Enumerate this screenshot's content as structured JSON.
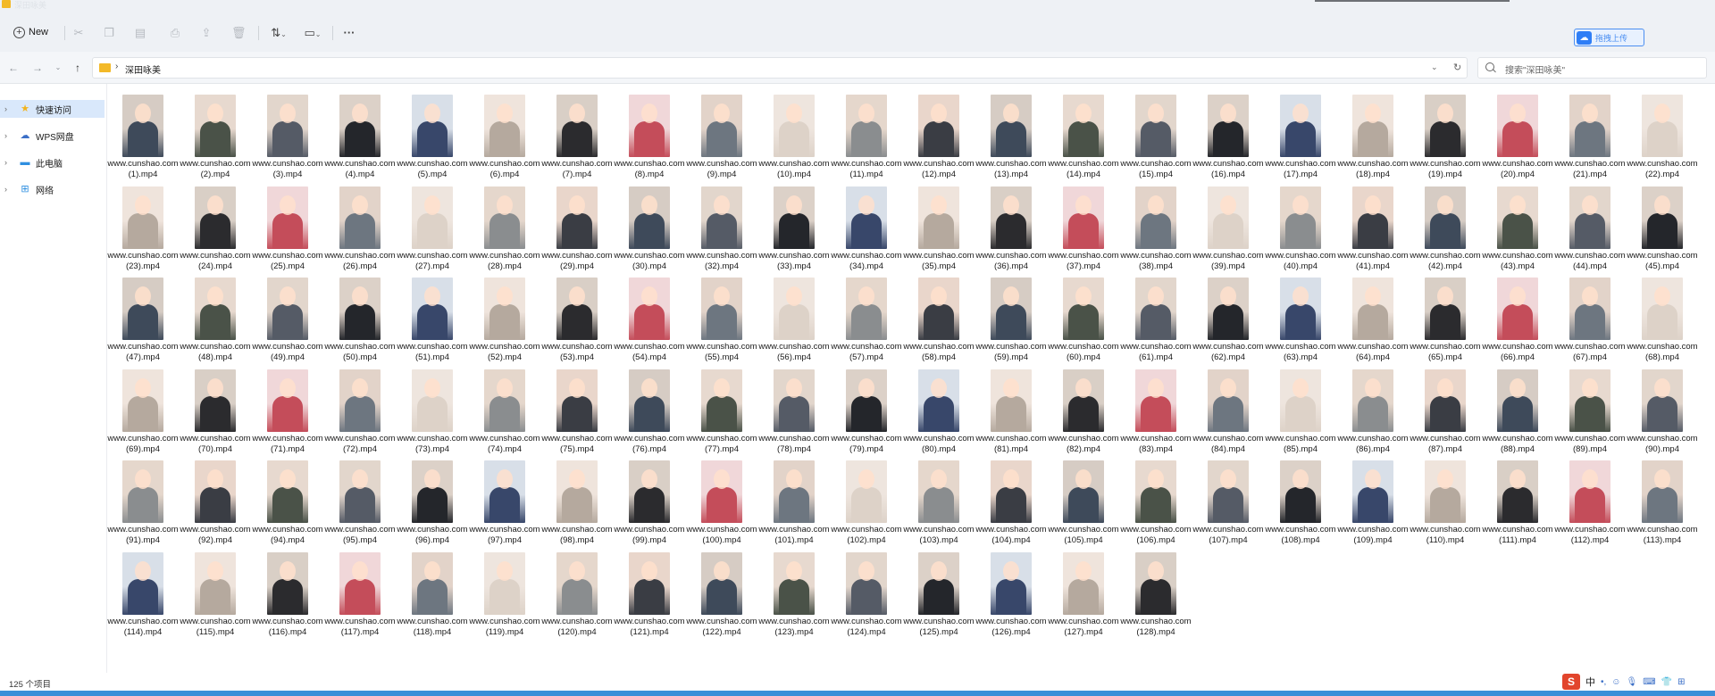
{
  "window": {
    "title": "深田咏美"
  },
  "toolbar": {
    "new_label": "New",
    "items": [
      "cut-icon",
      "copy-icon",
      "paste-icon",
      "rename-icon",
      "share-icon",
      "delete-icon",
      "sort-icon",
      "view-icon",
      "more-icon"
    ],
    "more_label": "···",
    "upload_label": "拖拽上传"
  },
  "address": {
    "path": "深田咏美",
    "search_placeholder": "搜索\"深田咏美\""
  },
  "sidebar": {
    "items": [
      {
        "label": "快速访问",
        "icon": "star-icon"
      },
      {
        "label": "WPS网盘",
        "icon": "cloud-icon"
      },
      {
        "label": "此电脑",
        "icon": "computer-icon"
      },
      {
        "label": "网络",
        "icon": "network-icon"
      }
    ]
  },
  "files": {
    "prefix": "www.cunshao.com (",
    "suffix": ").mp4",
    "numbers": [
      1,
      2,
      3,
      4,
      5,
      6,
      7,
      8,
      9,
      10,
      11,
      12,
      13,
      14,
      15,
      16,
      17,
      18,
      19,
      20,
      21,
      22,
      23,
      24,
      25,
      26,
      27,
      28,
      29,
      30,
      32,
      33,
      34,
      35,
      36,
      37,
      38,
      39,
      40,
      41,
      42,
      43,
      44,
      45,
      47,
      48,
      49,
      50,
      51,
      52,
      53,
      54,
      55,
      56,
      57,
      58,
      59,
      60,
      61,
      62,
      63,
      64,
      65,
      66,
      67,
      68,
      69,
      70,
      71,
      72,
      73,
      74,
      75,
      76,
      77,
      78,
      79,
      80,
      81,
      82,
      83,
      84,
      85,
      86,
      87,
      88,
      89,
      90,
      91,
      92,
      94,
      95,
      96,
      97,
      98,
      99,
      100,
      101,
      102,
      103,
      104,
      105,
      106,
      107,
      108,
      109,
      110,
      111,
      112,
      113,
      114,
      115,
      116,
      117,
      118,
      119,
      120,
      121,
      122,
      123,
      124,
      125,
      126,
      127,
      128
    ]
  },
  "status": {
    "count_text": "125 个项目"
  },
  "ime": {
    "badge": "S",
    "lang": "中"
  },
  "colors": {
    "accent": "#3a8fd8",
    "folder": "#f3b928",
    "selection": "#d9e8fb"
  }
}
